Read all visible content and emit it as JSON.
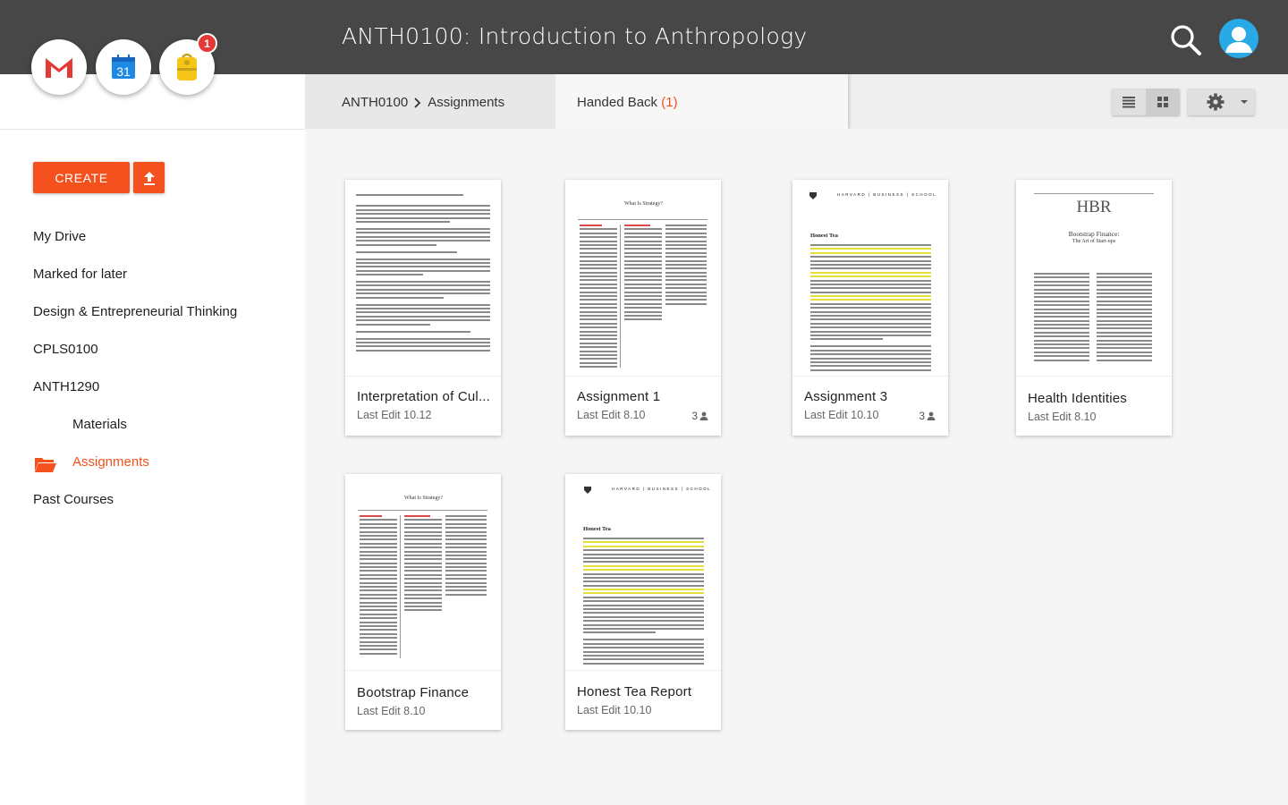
{
  "header": {
    "title": "ANTH0100: Introduction to Anthropology",
    "notification_count": "1",
    "apps": [
      {
        "name": "gmail-icon"
      },
      {
        "name": "calendar-icon",
        "label": "31"
      },
      {
        "name": "backpack-icon"
      }
    ]
  },
  "sidebar": {
    "create_label": "CREATE",
    "items": [
      {
        "label": "My Drive"
      },
      {
        "label": "Marked for later"
      },
      {
        "label": "Design & Entrepreneurial Thinking"
      },
      {
        "label": "CPLS0100"
      },
      {
        "label": "ANTH1290"
      },
      {
        "label": "Materials"
      },
      {
        "label": "Assignments"
      },
      {
        "label": "Past Courses"
      }
    ]
  },
  "toolbar": {
    "breadcrumb": [
      "ANTH0100",
      "Assignments"
    ],
    "handed_back_label": "Handed Back",
    "handed_back_count": "(1)"
  },
  "cards": [
    {
      "title": "Interpretation of Cul...",
      "date": "Last Edit 10.12",
      "shared": ""
    },
    {
      "title": "Assignment 1",
      "date": "Last Edit 8.10",
      "shared": "3"
    },
    {
      "title": "Assignment 3",
      "date": "Last Edit 10.10",
      "shared": "3"
    },
    {
      "title": "Health Identities",
      "date": "Last Edit 8.10",
      "shared": ""
    },
    {
      "title": "Bootstrap Finance",
      "date": "Last Edit 8.10",
      "shared": ""
    },
    {
      "title": "Honest Tea Report",
      "date": "Last Edit 10.10",
      "shared": ""
    }
  ],
  "thumbs": {
    "hbr_logo": "HBR",
    "hbr_title": "Bootstrap Finance:",
    "hbr_subtitle": "The Art of Start-ups",
    "hbs_header": "HARVARD | BUSINESS | SCHOOL",
    "honest_tea": "Honest Tea",
    "what_is_strategy": "What Is Strategy?"
  },
  "colors": {
    "accent": "#f4511e",
    "topbar": "#474747",
    "avatar": "#29a9e6",
    "badge": "#e53935"
  }
}
